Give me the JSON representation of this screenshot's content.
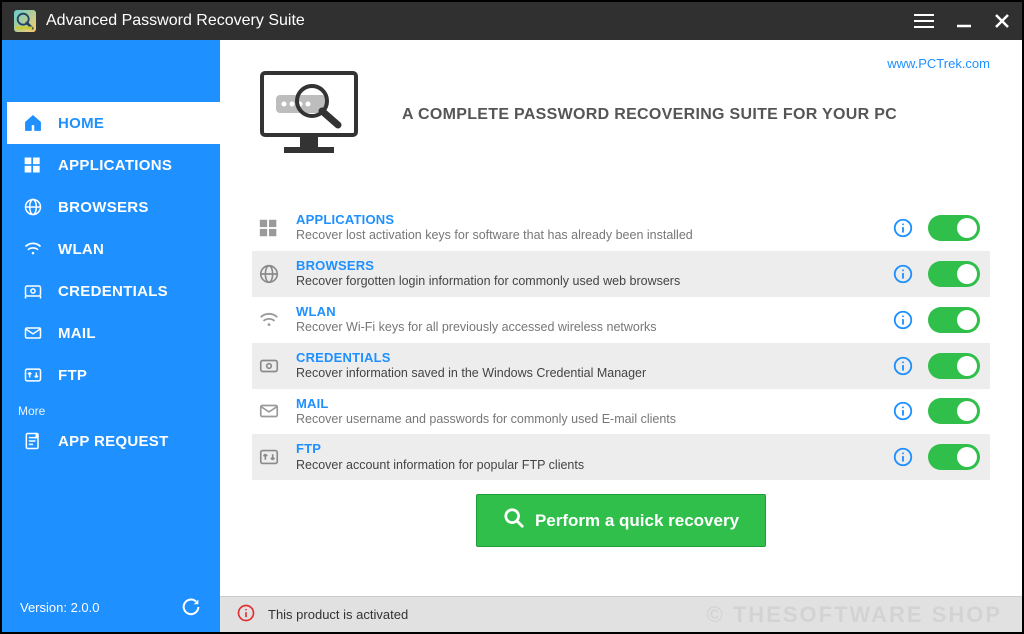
{
  "app": {
    "title": "Advanced Password Recovery Suite"
  },
  "link": {
    "label": "www.PCTrek.com"
  },
  "hero": {
    "headline": "A COMPLETE PASSWORD RECOVERING SUITE FOR YOUR PC"
  },
  "sidebar": {
    "items": {
      "home": "HOME",
      "applications": "APPLICATIONS",
      "browsers": "BROWSERS",
      "wlan": "WLAN",
      "credentials": "CREDENTIALS",
      "mail": "MAIL",
      "ftp": "FTP"
    },
    "more_label": "More",
    "app_request": "APP REQUEST",
    "version_label": "Version: 2.0.0"
  },
  "categories": {
    "applications": {
      "title": "APPLICATIONS",
      "desc": "Recover lost activation keys for software that has already been installed"
    },
    "browsers": {
      "title": "BROWSERS",
      "desc": "Recover forgotten login information for commonly used web browsers"
    },
    "wlan": {
      "title": "WLAN",
      "desc": "Recover Wi-Fi keys for all previously accessed wireless networks"
    },
    "credentials": {
      "title": "CREDENTIALS",
      "desc": "Recover information saved in the Windows Credential Manager"
    },
    "mail": {
      "title": "MAIL",
      "desc": "Recover username and passwords for commonly used E-mail clients"
    },
    "ftp": {
      "title": "FTP",
      "desc": "Recover account information for popular FTP clients"
    }
  },
  "action": {
    "perform_label": "Perform a quick recovery"
  },
  "status": {
    "message": "This product is activated"
  },
  "watermark": "© THESOFTWARE SHOP"
}
